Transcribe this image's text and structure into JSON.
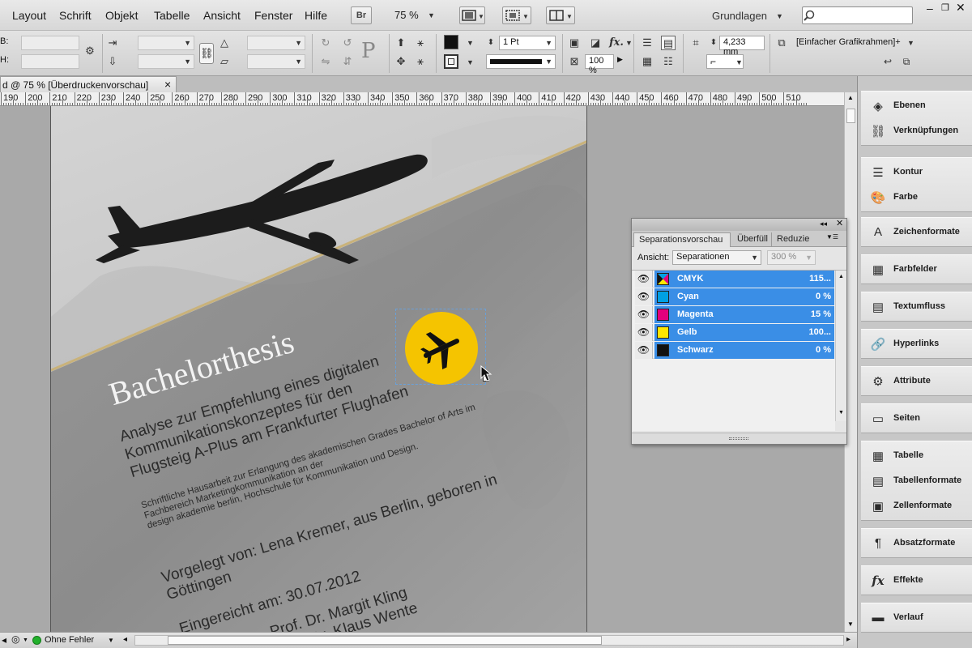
{
  "menu": {
    "items": [
      "Layout",
      "Schrift",
      "Objekt",
      "Tabelle",
      "Ansicht",
      "Fenster",
      "Hilfe"
    ],
    "bridge_label": "Br",
    "zoom": "75 %",
    "workspace": "Grundlagen"
  },
  "controlbar": {
    "label_b": "B:",
    "label_h": "H:",
    "stroke_weight": "1 Pt",
    "offset_value": "4,233 mm",
    "opacity": "100 %",
    "frame_style": "[Einfacher Grafikrahmen]+",
    "fx_label": "fx."
  },
  "doctab": {
    "title": "d @ 75 % [Überdruckenvorschau]",
    "close": "×"
  },
  "ruler": {
    "labels": [
      "190",
      "200",
      "210",
      "220",
      "230",
      "240",
      "250",
      "260",
      "270",
      "280",
      "290",
      "300",
      "310",
      "320",
      "330",
      "340",
      "350",
      "360",
      "370",
      "380",
      "390",
      "400",
      "410",
      "420",
      "430",
      "440",
      "450",
      "460",
      "470",
      "480",
      "490",
      "500",
      "510"
    ]
  },
  "document": {
    "title": "Bachelorthesis",
    "subtitle_lines": [
      "Analyse zur Empfehlung eines digitalen",
      "Kommunikationskonzeptes für den",
      "Flugsteig A-Plus am Frankfurter Flughafen"
    ],
    "small_lines": [
      "Schriftliche Hausarbeit zur Erlangung des akademischen Grades Bachelor of Arts im",
      "Fachbereich Marketingkommunikation an der",
      "design akademie berlin, Hochschule für Kommunikation und Design."
    ],
    "submitted_by_lines": [
      "Vorgelegt von: Lena Kremer, aus Berlin, geboren in",
      "Göttingen"
    ],
    "submitted_date": "Eingereicht am: 30.07.2012",
    "advisor_lines": [
      "Prof. Dr. Margit Kling",
      "Prof. Dr. Klaus Wente"
    ]
  },
  "separations": {
    "tabs": [
      "Separationsvorschau",
      "Überfüll",
      "Reduzie"
    ],
    "view_label": "Ansicht:",
    "view_value": "Separationen",
    "zoom_value": "300 %",
    "rows": [
      {
        "name": "CMYK",
        "value": "115...",
        "color": "multi"
      },
      {
        "name": "Cyan",
        "value": "0 %",
        "color": "#00a0e3"
      },
      {
        "name": "Magenta",
        "value": "15 %",
        "color": "#e4007d"
      },
      {
        "name": "Gelb",
        "value": "100...",
        "color": "#ffe600"
      },
      {
        "name": "Schwarz",
        "value": "0 %",
        "color": "#111111"
      }
    ]
  },
  "dock": {
    "items": [
      "Ebenen",
      "Verknüpfungen",
      "Kontur",
      "Farbe",
      "Zeichenformate",
      "Farbfelder",
      "Textumfluss",
      "Hyperlinks",
      "Attribute",
      "Seiten",
      "Tabelle",
      "Tabellenformate",
      "Zellenformate",
      "Absatzformate",
      "Effekte",
      "Verlauf"
    ]
  },
  "status": {
    "preflight": "Ohne Fehler"
  },
  "colors": {
    "accent": "#3a8ee6",
    "yellow": "#f5c400",
    "line_gold": "#c9b27a"
  }
}
